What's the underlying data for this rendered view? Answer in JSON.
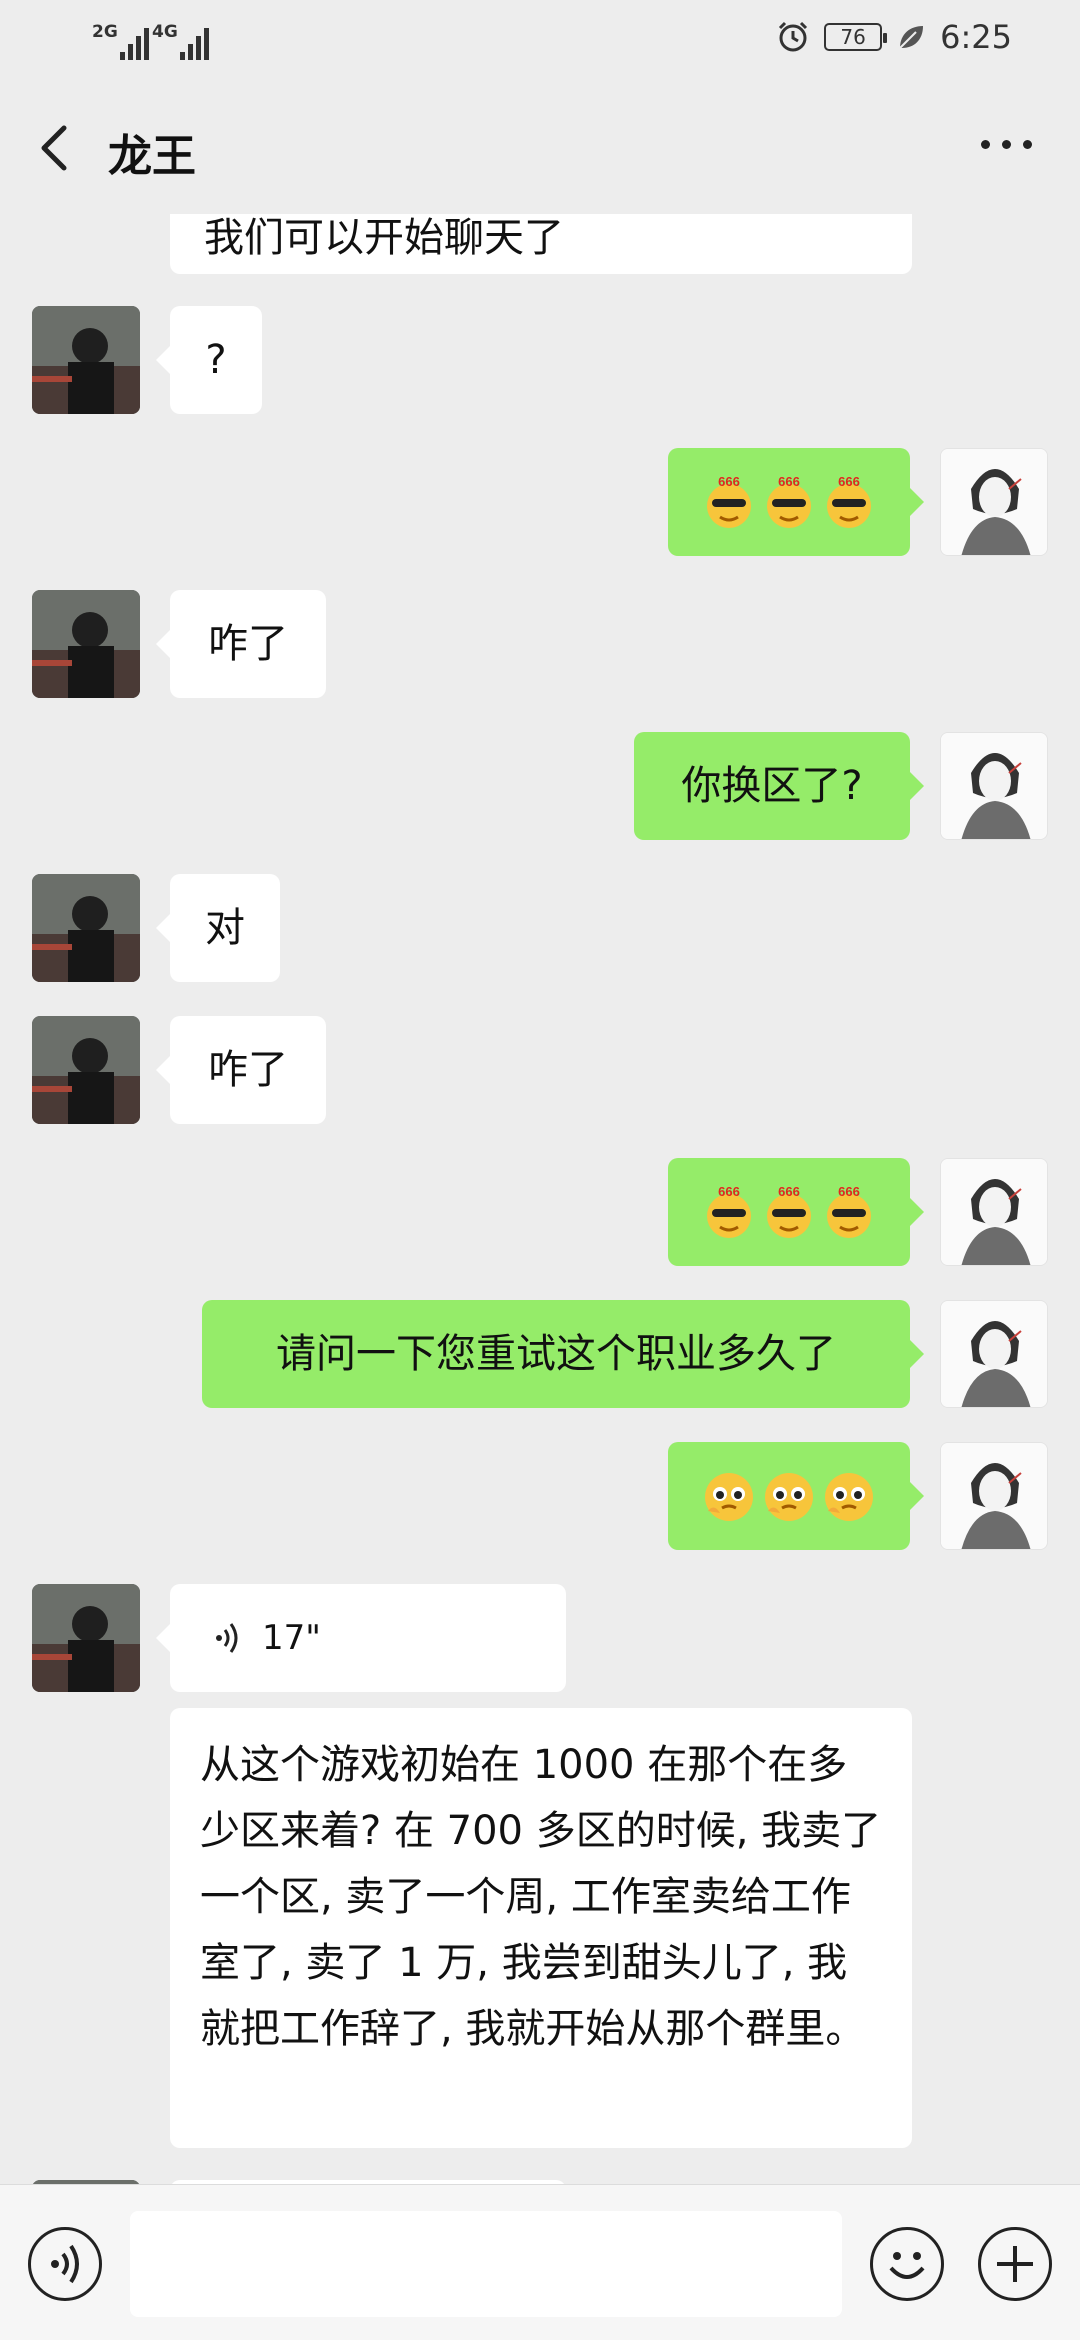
{
  "status_bar": {
    "signal_1_label": "2G",
    "signal_2_label": "4G",
    "battery": "76",
    "time": "6:25"
  },
  "header": {
    "title": "龙王"
  },
  "messages": [
    {
      "side": "in",
      "type": "text",
      "text": "我们可以开始聊天了"
    },
    {
      "side": "in",
      "type": "text",
      "text": "?"
    },
    {
      "side": "out",
      "type": "emoji",
      "emoji": [
        "666-sunglasses-emoji",
        "666-sunglasses-emoji",
        "666-sunglasses-emoji"
      ]
    },
    {
      "side": "in",
      "type": "text",
      "text": "咋了"
    },
    {
      "side": "out",
      "type": "text",
      "text": "你换区了?"
    },
    {
      "side": "in",
      "type": "text",
      "text": "对"
    },
    {
      "side": "in",
      "type": "text",
      "text": "咋了"
    },
    {
      "side": "out",
      "type": "emoji",
      "emoji": [
        "666-sunglasses-emoji",
        "666-sunglasses-emoji",
        "666-sunglasses-emoji"
      ]
    },
    {
      "side": "out",
      "type": "text",
      "text": "请问一下您重试这个职业多久了"
    },
    {
      "side": "out",
      "type": "emoji",
      "emoji": [
        "pleading-face-emoji",
        "pleading-face-emoji",
        "pleading-face-emoji"
      ]
    },
    {
      "side": "in",
      "type": "voice",
      "duration": "17\""
    },
    {
      "side": "in",
      "type": "transcript",
      "text": "从这个游戏初始在 1000 在那个在多少区来着? 在 700 多区的时候, 我卖了一个区, 卖了一个周, 工作室卖给工作室了, 卖了 1 万, 我尝到甜头儿了, 我就把工作辞了, 我就开始从那个群里。"
    }
  ],
  "input_bar": {
    "voice_button": "voice-icon",
    "emoji_button": "smiley-icon",
    "plus_button": "plus-icon"
  },
  "colors": {
    "background": "#ededed",
    "outgoing_bubble": "#95ec69",
    "incoming_bubble": "#ffffff"
  }
}
